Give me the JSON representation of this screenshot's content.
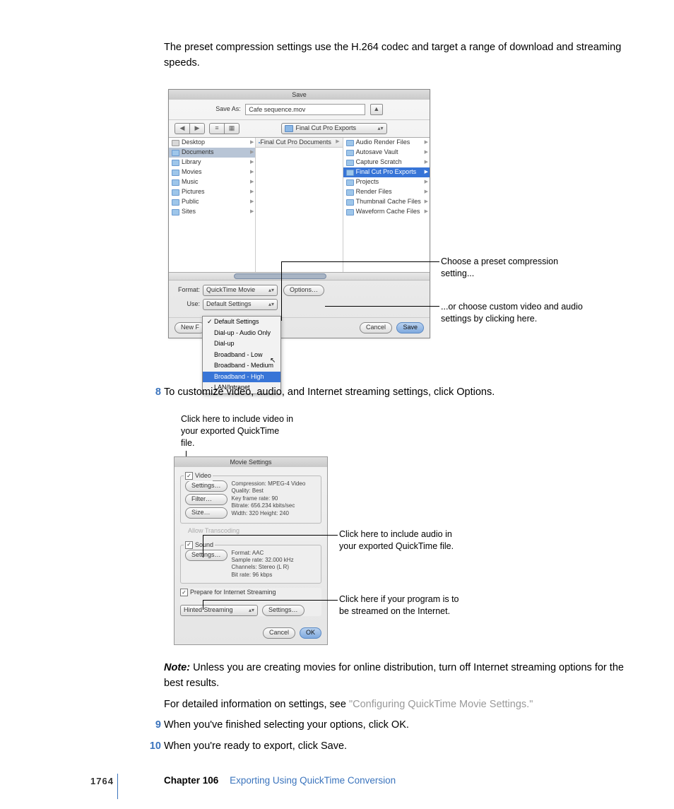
{
  "intro": "The preset compression settings use the H.264 codec and target a range of download and streaming speeds.",
  "saveDialog": {
    "title": "Save",
    "saveAsLabel": "Save As:",
    "saveAsValue": "Cafe sequence.mov",
    "toggleGlyph": "▲",
    "backGlyph": "◀",
    "fwdGlyph": "▶",
    "viewIcons": "≡",
    "viewGrid": "▦",
    "pathLabel": "Final Cut Pro Exports",
    "arrows": "▴▾",
    "col1": [
      "Desktop",
      "Documents",
      "Library",
      "Movies",
      "Music",
      "Pictures",
      "Public",
      "Sites"
    ],
    "col1SelectedIndex": 1,
    "col2Header": "Final Cut Pro Documents",
    "col3": [
      "Audio Render Files",
      "Autosave Vault",
      "Capture Scratch",
      "Final Cut Pro Exports",
      "Projects",
      "Render Files",
      "Thumbnail Cache Files",
      "Waveform Cache Files"
    ],
    "col3HighlightIndex": 3,
    "formatLabel": "Format:",
    "formatValue": "QuickTime Movie",
    "useLabel": "Use:",
    "useValue": "Default Settings",
    "optionsBtn": "Options…",
    "newFolderBtn": "New F",
    "cancelBtn": "Cancel",
    "saveBtn": "Save",
    "dropdown": [
      "Default Settings",
      "Dial-up - Audio Only",
      "Dial-up",
      "Broadband - Low",
      "Broadband - Medium",
      "Broadband - High",
      "LAN/Intranet"
    ],
    "dropdownSelectedIndex": 5
  },
  "callouts": {
    "preset": "Choose a preset compression setting...",
    "custom": "...or choose custom video and audio settings by clicking here.",
    "videoCb": "Click here to include video in your exported QuickTime file.",
    "audioCb": "Click here to include audio in your exported QuickTime file.",
    "streamCb": "Click here if your program is to be streamed on the Internet."
  },
  "step8": {
    "num": "8",
    "text": "To customize video, audio, and Internet streaming settings, click Options."
  },
  "movieSettings": {
    "title": "Movie Settings",
    "video": {
      "label": "Video",
      "settings": "Settings…",
      "filter": "Filter…",
      "size": "Size…",
      "info": "Compression: MPEG-4 Video\nQuality: Best\nKey frame rate: 90\nBitrate: 656.234 kbits/sec\nWidth: 320 Height: 240"
    },
    "allowTranscoding": "Allow Transcoding",
    "sound": {
      "label": "Sound",
      "settings": "Settings…",
      "info": "Format: AAC\nSample rate: 32.000 kHz\nChannels: Stereo (L R)\nBit rate: 96 kbps"
    },
    "stream": {
      "label": "Prepare for Internet Streaming",
      "mode": "Hinted Streaming",
      "settings": "Settings…"
    },
    "cancel": "Cancel",
    "ok": "OK",
    "check": "✓"
  },
  "noteLabel": "Note:",
  "noteText": "  Unless you are creating movies for online distribution, turn off Internet streaming options for the best results.",
  "detailText": "For detailed information on settings, see ",
  "detailLink": "\"Configuring QuickTime Movie Settings.\"",
  "step9": {
    "num": "9",
    "text": "When you've finished selecting your options, click OK."
  },
  "step10": {
    "num": "10",
    "text": "When you're ready to export, click Save."
  },
  "footer": {
    "page": "1764",
    "chapter": "Chapter 106",
    "title": "Exporting Using QuickTime Conversion"
  }
}
